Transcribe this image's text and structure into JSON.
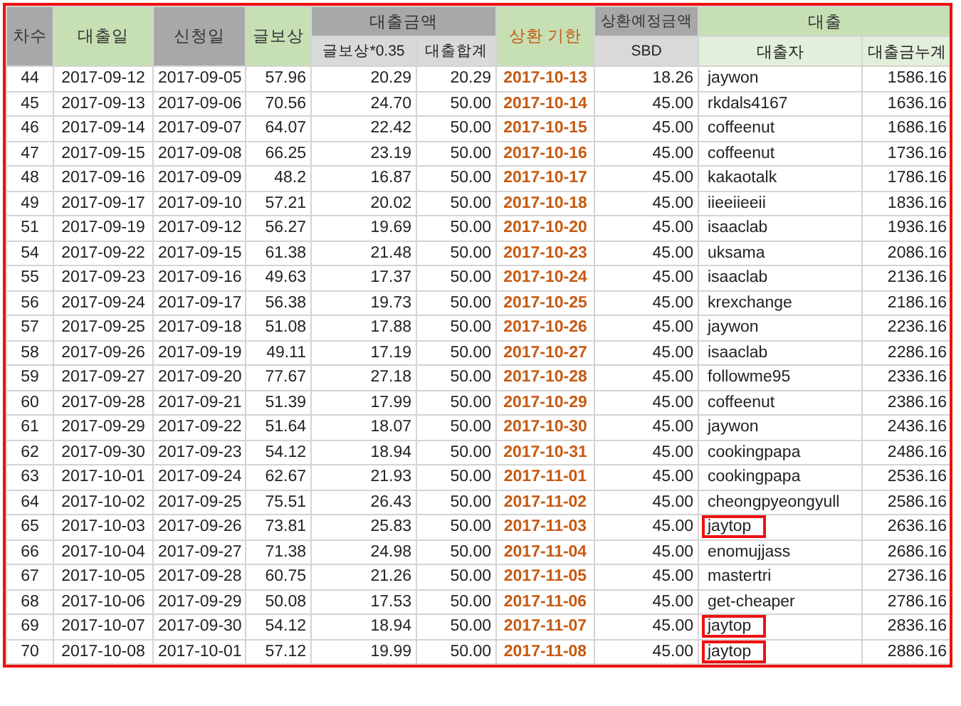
{
  "header": {
    "top": [
      {
        "label": "차수"
      },
      {
        "label": "대출일"
      },
      {
        "label": "신청일"
      },
      {
        "label": "글보상"
      },
      {
        "label": "대출금액",
        "sub": [
          "글보상*0.35",
          "대출합계"
        ]
      },
      {
        "label": "상환 기한"
      },
      {
        "label": "상환예정금액",
        "sub": [
          "SBD"
        ]
      },
      {
        "label": "대출",
        "sub": [
          "대출자",
          "대출금누계"
        ]
      }
    ]
  },
  "rows": [
    {
      "cells": [
        "44",
        "2017-09-12",
        "2017-09-05",
        "57.96",
        "20.29",
        "20.29",
        "2017-10-13",
        "18.26",
        "jaywon",
        "1586.16"
      ],
      "highlighted": false
    },
    {
      "cells": [
        "45",
        "2017-09-13",
        "2017-09-06",
        "70.56",
        "24.70",
        "50.00",
        "2017-10-14",
        "45.00",
        "rkdals4167",
        "1636.16"
      ],
      "highlighted": false
    },
    {
      "cells": [
        "46",
        "2017-09-14",
        "2017-09-07",
        "64.07",
        "22.42",
        "50.00",
        "2017-10-15",
        "45.00",
        "coffeenut",
        "1686.16"
      ],
      "highlighted": false
    },
    {
      "cells": [
        "47",
        "2017-09-15",
        "2017-09-08",
        "66.25",
        "23.19",
        "50.00",
        "2017-10-16",
        "45.00",
        "coffeenut",
        "1736.16"
      ],
      "highlighted": false
    },
    {
      "cells": [
        "48",
        "2017-09-16",
        "2017-09-09",
        "48.2",
        "16.87",
        "50.00",
        "2017-10-17",
        "45.00",
        "kakaotalk",
        "1786.16"
      ],
      "highlighted": false
    },
    {
      "cells": [
        "49",
        "2017-09-17",
        "2017-09-10",
        "57.21",
        "20.02",
        "50.00",
        "2017-10-18",
        "45.00",
        "iieeiieeii",
        "1836.16"
      ],
      "highlighted": false
    },
    {
      "cells": [
        "51",
        "2017-09-19",
        "2017-09-12",
        "56.27",
        "19.69",
        "50.00",
        "2017-10-20",
        "45.00",
        "isaaclab",
        "1936.16"
      ],
      "highlighted": false
    },
    {
      "cells": [
        "54",
        "2017-09-22",
        "2017-09-15",
        "61.38",
        "21.48",
        "50.00",
        "2017-10-23",
        "45.00",
        "uksama",
        "2086.16"
      ],
      "highlighted": false
    },
    {
      "cells": [
        "55",
        "2017-09-23",
        "2017-09-16",
        "49.63",
        "17.37",
        "50.00",
        "2017-10-24",
        "45.00",
        "isaaclab",
        "2136.16"
      ],
      "highlighted": false
    },
    {
      "cells": [
        "56",
        "2017-09-24",
        "2017-09-17",
        "56.38",
        "19.73",
        "50.00",
        "2017-10-25",
        "45.00",
        "krexchange",
        "2186.16"
      ],
      "highlighted": false
    },
    {
      "cells": [
        "57",
        "2017-09-25",
        "2017-09-18",
        "51.08",
        "17.88",
        "50.00",
        "2017-10-26",
        "45.00",
        "jaywon",
        "2236.16"
      ],
      "highlighted": false
    },
    {
      "cells": [
        "58",
        "2017-09-26",
        "2017-09-19",
        "49.11",
        "17.19",
        "50.00",
        "2017-10-27",
        "45.00",
        "isaaclab",
        "2286.16"
      ],
      "highlighted": false
    },
    {
      "cells": [
        "59",
        "2017-09-27",
        "2017-09-20",
        "77.67",
        "27.18",
        "50.00",
        "2017-10-28",
        "45.00",
        "followme95",
        "2336.16"
      ],
      "highlighted": false
    },
    {
      "cells": [
        "60",
        "2017-09-28",
        "2017-09-21",
        "51.39",
        "17.99",
        "50.00",
        "2017-10-29",
        "45.00",
        "coffeenut",
        "2386.16"
      ],
      "highlighted": false
    },
    {
      "cells": [
        "61",
        "2017-09-29",
        "2017-09-22",
        "51.64",
        "18.07",
        "50.00",
        "2017-10-30",
        "45.00",
        "jaywon",
        "2436.16"
      ],
      "highlighted": false
    },
    {
      "cells": [
        "62",
        "2017-09-30",
        "2017-09-23",
        "54.12",
        "18.94",
        "50.00",
        "2017-10-31",
        "45.00",
        "cookingpapa",
        "2486.16"
      ],
      "highlighted": false
    },
    {
      "cells": [
        "63",
        "2017-10-01",
        "2017-09-24",
        "62.67",
        "21.93",
        "50.00",
        "2017-11-01",
        "45.00",
        "cookingpapa",
        "2536.16"
      ],
      "highlighted": false
    },
    {
      "cells": [
        "64",
        "2017-10-02",
        "2017-09-25",
        "75.51",
        "26.43",
        "50.00",
        "2017-11-02",
        "45.00",
        "cheongpyeongyull",
        "2586.16"
      ],
      "highlighted": false
    },
    {
      "cells": [
        "65",
        "2017-10-03",
        "2017-09-26",
        "73.81",
        "25.83",
        "50.00",
        "2017-11-03",
        "45.00",
        "jaytop",
        "2636.16"
      ],
      "highlighted": true
    },
    {
      "cells": [
        "66",
        "2017-10-04",
        "2017-09-27",
        "71.38",
        "24.98",
        "50.00",
        "2017-11-04",
        "45.00",
        "enomujjass",
        "2686.16"
      ],
      "highlighted": false
    },
    {
      "cells": [
        "67",
        "2017-10-05",
        "2017-09-28",
        "60.75",
        "21.26",
        "50.00",
        "2017-11-05",
        "45.00",
        "mastertri",
        "2736.16"
      ],
      "highlighted": false
    },
    {
      "cells": [
        "68",
        "2017-10-06",
        "2017-09-29",
        "50.08",
        "17.53",
        "50.00",
        "2017-11-06",
        "45.00",
        "get-cheaper",
        "2786.16"
      ],
      "highlighted": false
    },
    {
      "cells": [
        "69",
        "2017-10-07",
        "2017-09-30",
        "54.12",
        "18.94",
        "50.00",
        "2017-11-07",
        "45.00",
        "jaytop",
        "2836.16"
      ],
      "highlighted": true
    },
    {
      "cells": [
        "70",
        "2017-10-08",
        "2017-10-01",
        "57.12",
        "19.99",
        "50.00",
        "2017-11-08",
        "45.00",
        "jaytop",
        "2886.16"
      ],
      "highlighted": true
    }
  ]
}
